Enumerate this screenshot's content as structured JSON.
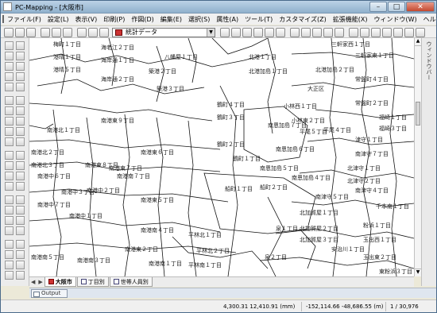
{
  "window": {
    "title": "PC-Mapping - [大阪市]"
  },
  "menu": [
    "ファイル(F)",
    "設定(L)",
    "表示(V)",
    "印刷(P)",
    "作図(D)",
    "編集(E)",
    "選択(S)",
    "属性(A)",
    "ツール(T)",
    "カスタマイズ(Z)",
    "拡張機能(X)",
    "ウィンドウ(W)",
    "ヘルプ(H)"
  ],
  "toolbar": {
    "layer_combo": "統計データ"
  },
  "side_panel": {
    "label": "ウィンドウバー"
  },
  "tabs": [
    {
      "label": "大阪市",
      "active": true
    },
    {
      "label": "丁目別",
      "active": false
    },
    {
      "label": "世帯人員別",
      "active": false
    }
  ],
  "output_tab": "Output",
  "status": {
    "coord_mm": "4,300.31 12,410.91 (mm)",
    "coord_m": "-152,114.66 -48,686.55 (m)",
    "count": "1 / 30,976"
  },
  "map_labels": [
    "梅町１丁目",
    "海老江２丁目",
    "八幡屋１丁目",
    "北港１丁目",
    "北港加島１丁目",
    "北港加島２丁目",
    "三軒家東１丁目",
    "常盤町４丁目",
    "常盤町２丁目",
    "南港北１丁目",
    "南港東９丁目",
    "南港東６丁目",
    "南港東５丁目",
    "南港東２丁目",
    "南港中６丁目",
    "南港中３丁目",
    "南港中２丁目",
    "南港中１丁目",
    "南港中７丁目",
    "南港南５丁目",
    "南港南３丁目",
    "南港南１丁目",
    "南港南４丁目",
    "南港南７丁目",
    "南港東８丁目",
    "南港東７丁目",
    "鶴町４丁目",
    "鶴町３丁目",
    "鶴町２丁目",
    "鶴町１丁目",
    "船町１丁目",
    "船町２丁目",
    "小林西１丁目",
    "小林東２丁目",
    "平尾５丁目",
    "平尾４丁目",
    "南恩加島７丁目",
    "南恩加島６丁目",
    "南恩加島５丁目",
    "南恩加島４丁目",
    "北加賀屋１丁目",
    "北加賀屋２丁目",
    "北加賀屋３丁目",
    "平林北１丁目",
    "平林北２丁目",
    "平林南１丁目",
    "泉１丁目",
    "泉２丁目",
    "安治川１丁目",
    "南津守５丁目",
    "南津守４丁目",
    "南津守７丁目",
    "津守１丁目",
    "北津守１丁目",
    "北津守２丁目",
    "千本南１丁目",
    "粉浜１丁目",
    "玉出西１丁目",
    "玉出東２丁目",
    "東粉浜３丁目",
    "南港北２丁目",
    "南港北３丁目",
    "海岸通１丁目",
    "海岸通２丁目",
    "築港２丁目",
    "築港３丁目",
    "港晴１丁目",
    "港晴５丁目",
    "福崎１丁目",
    "福崎３丁目",
    "大正区",
    "三軒家西１丁目"
  ]
}
